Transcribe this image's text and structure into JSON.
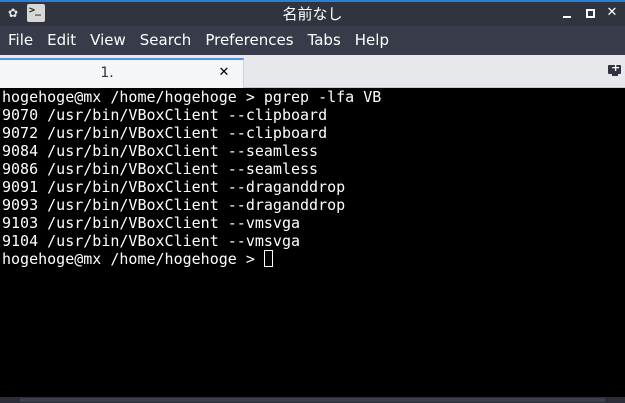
{
  "window": {
    "title": "名前なし",
    "menu_glyph": "✿",
    "close_glyph": "✕"
  },
  "menubar": {
    "items": [
      "File",
      "Edit",
      "View",
      "Search",
      "Preferences",
      "Tabs",
      "Help"
    ]
  },
  "tabs": [
    {
      "label": "1.",
      "close_glyph": "✕",
      "active": true
    }
  ],
  "app_icon": {
    "glyph": ">_"
  },
  "terminal": {
    "lines": [
      "hogehoge@mx /home/hogehoge > pgrep -lfa VB",
      "9070 /usr/bin/VBoxClient --clipboard",
      "9072 /usr/bin/VBoxClient --clipboard",
      "9084 /usr/bin/VBoxClient --seamless",
      "9086 /usr/bin/VBoxClient --seamless",
      "9091 /usr/bin/VBoxClient --draganddrop",
      "9093 /usr/bin/VBoxClient --draganddrop",
      "9103 /usr/bin/VBoxClient --vmsvga",
      "9104 /usr/bin/VBoxClient --vmsvga"
    ],
    "prompt": "hogehoge@mx /home/hogehoge > "
  },
  "colors": {
    "titlebar_bg": "#2f343f",
    "titlebar_accent": "#2d7dd2",
    "menubar_bg": "#383c4a",
    "tabbar_bg": "#e7e8eb",
    "tab_active_accent": "#5294e2",
    "terminal_bg": "#000000",
    "terminal_fg": "#ffffff"
  },
  "icons": {
    "window_menu": "window-menu-icon",
    "app": "terminal-app-icon",
    "minimize": "minimize-icon",
    "maximize": "maximize-icon",
    "close": "close-icon",
    "tab_close": "tab-close-icon",
    "new_tab": "new-tab-icon"
  }
}
